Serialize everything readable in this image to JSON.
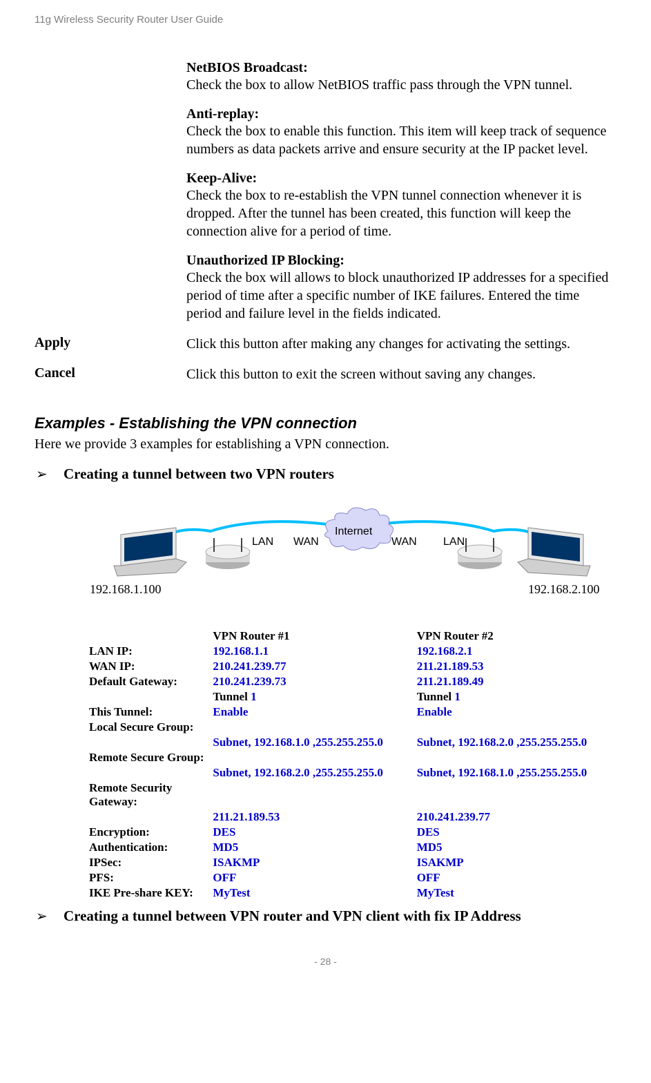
{
  "header": "11g Wireless Security Router User Guide",
  "definitions": [
    {
      "heading": "NetBIOS Broadcast:",
      "body": "Check the box to allow NetBIOS traffic pass through the VPN tunnel."
    },
    {
      "heading": "Anti-replay:",
      "body": "Check the box to enable this function. This item will keep track of sequence numbers as data packets arrive and ensure security at the IP packet level."
    },
    {
      "heading": "Keep-Alive:",
      "body": "Check the box to re-establish the VPN tunnel connection whenever it is dropped. After the tunnel has been created, this function will keep the connection alive for a period of time."
    },
    {
      "heading": "Unauthorized IP Blocking:",
      "body": "Check the box will allows to block unauthorized IP addresses for a specified period of time after a specific number of IKE failures. Entered the time period and failure level in the fields indicated."
    }
  ],
  "rows": [
    {
      "label": "Apply",
      "text": "Click this button after making any changes for activating the settings."
    },
    {
      "label": "Cancel",
      "text": "Click this button to exit the screen without saving any changes."
    }
  ],
  "section": {
    "heading": "Examples - Establishing the VPN connection",
    "intro": "Here we provide 3 examples for establishing a VPN connection."
  },
  "bullets": [
    {
      "arrow": "➢",
      "text": "Creating a tunnel between two VPN routers"
    },
    {
      "arrow": "➢",
      "text": "Creating a tunnel between VPN router and VPN client with fix IP Address"
    }
  ],
  "diagram": {
    "ip_left": "192.168.1.100",
    "ip_right": "192.168.2.100",
    "lan": "LAN",
    "wan": "WAN",
    "internet": "Internet"
  },
  "table": {
    "header": {
      "c1": "",
      "c2": "VPN Router #1",
      "c3": "VPN Router  #2"
    },
    "rows": [
      {
        "label": "LAN IP:",
        "v1": "192.168.1.1",
        "v2": "192.168.2.1"
      },
      {
        "label": "WAN IP:",
        "v1": "210.241.239.77",
        "v2": "211.21.189.53"
      },
      {
        "label": "Default Gateway:",
        "v1": "210.241.239.73",
        "v2": "211.21.189.49"
      },
      {
        "label": "",
        "v1": "Tunnel 1",
        "v2": "Tunnel 1",
        "black": true
      },
      {
        "label": "This Tunnel:",
        "v1": "Enable",
        "v2": "Enable"
      },
      {
        "label": "Local Secure Group:",
        "v1": "",
        "v2": ""
      },
      {
        "label": "",
        "v1": "Subnet, 192.168.1.0 ,255.255.255.0",
        "v2": "Subnet, 192.168.2.0 ,255.255.255.0"
      },
      {
        "label": "Remote Secure Group:",
        "v1": "",
        "v2": ""
      },
      {
        "label": "",
        "v1": "Subnet, 192.168.2.0 ,255.255.255.0",
        "v2": "Subnet, 192.168.1.0 ,255.255.255.0"
      },
      {
        "label": "Remote Security Gateway:",
        "v1": "",
        "v2": ""
      },
      {
        "label": "",
        "v1": "211.21.189.53",
        "v2": "210.241.239.77"
      },
      {
        "label": "Encryption:",
        "v1": "DES",
        "v2": "DES"
      },
      {
        "label": "Authentication:",
        "v1": "MD5",
        "v2": "MD5"
      },
      {
        "label": "IPSec:",
        "v1": "ISAKMP",
        "v2": "ISAKMP"
      },
      {
        "label": "PFS:",
        "v1": "OFF",
        "v2": "OFF"
      },
      {
        "label": "IKE Pre-share KEY:",
        "v1": "MyTest",
        "v2": "MyTest"
      }
    ]
  },
  "footer": "- 28 -"
}
